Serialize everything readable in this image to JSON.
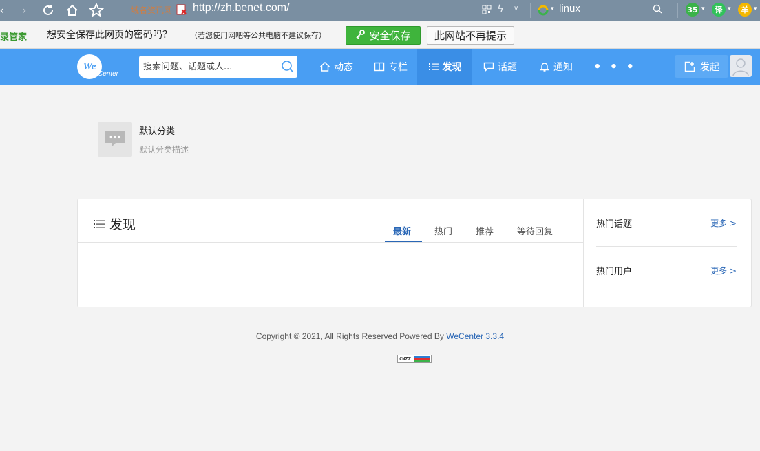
{
  "browser": {
    "site_label": "域名资讯网",
    "url": "http://zh.benet.com/",
    "search_query": "linux",
    "extensions": [
      "35",
      "译",
      "羊"
    ]
  },
  "password_prompt": {
    "brand": "录管家",
    "question": "想安全保存此网页的密码吗？",
    "hint": "（若您使用网吧等公共电脑不建议保存）",
    "save_label": "安全保存",
    "never_label": "此网站不再提示"
  },
  "header": {
    "logo_text": "We",
    "logo_subtext": "Center",
    "search_placeholder": "搜索问题、话题或人...",
    "nav": [
      {
        "label": "动态"
      },
      {
        "label": "专栏"
      },
      {
        "label": "发现"
      },
      {
        "label": "话题"
      },
      {
        "label": "通知"
      }
    ],
    "more_label": "• • •",
    "post_label": "发起"
  },
  "category": {
    "title": "默认分类",
    "description": "默认分类描述"
  },
  "panel": {
    "heading": "发现",
    "tabs": [
      "最新",
      "热门",
      "推荐",
      "等待回复"
    ],
    "active_tab": "最新",
    "sidebar": [
      {
        "label": "热门话题",
        "more": "更多 >"
      },
      {
        "label": "热门用户",
        "more": "更多 >"
      }
    ]
  },
  "footer": {
    "copyright": "Copyright © 2021, All Rights Reserved Powered By",
    "brand": "WeCenter 3.3.4",
    "badge": "CNZZ"
  },
  "colors": {
    "header_bg": "#499ef3",
    "nav_active_bg": "#3a8ee6",
    "link_blue": "#2a67b6",
    "save_green": "#3fb43c",
    "browser_bar": "#7a8fa2"
  }
}
